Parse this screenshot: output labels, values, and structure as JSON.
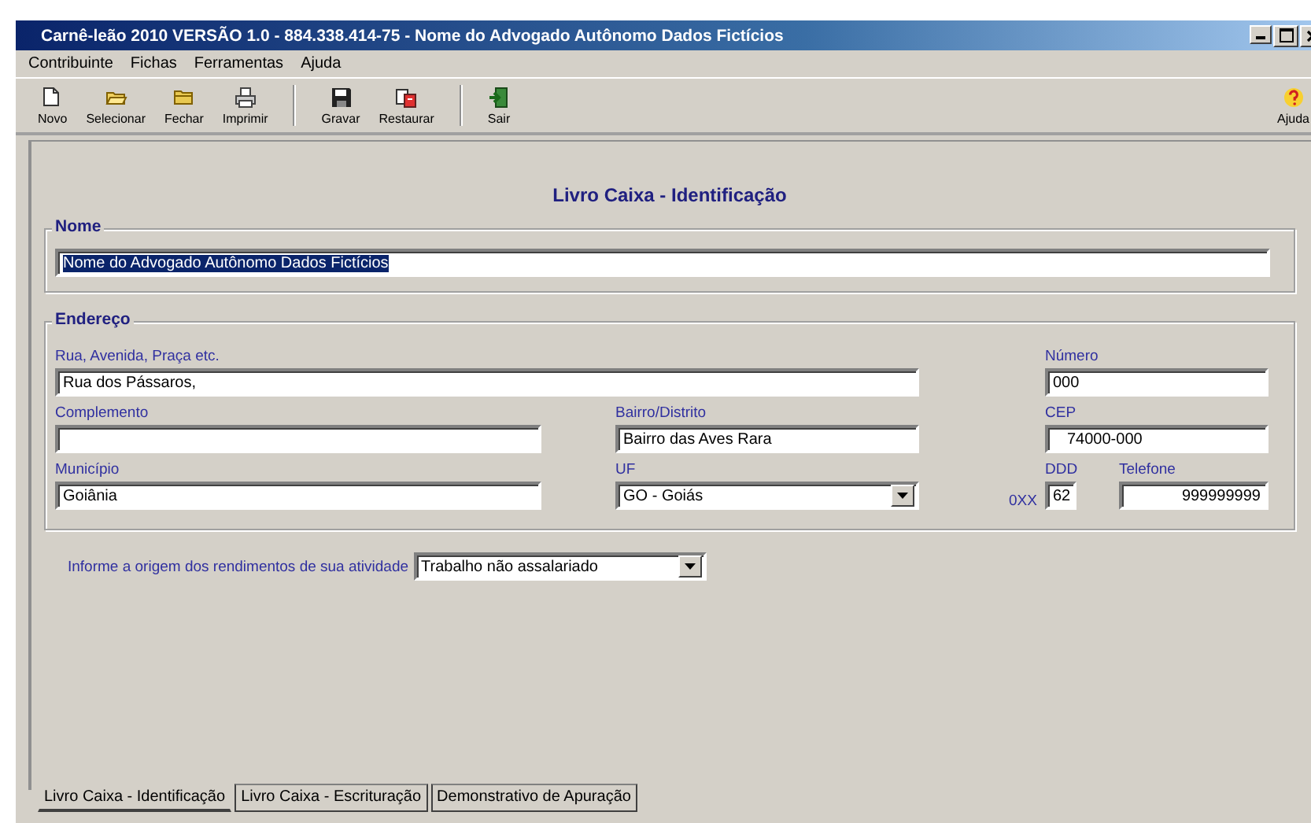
{
  "window": {
    "title": "Carnê-leão 2010 VERSÃO 1.0 - 884.338.414-75 - Nome do Advogado Autônomo Dados Fictícios"
  },
  "menu": [
    "Contribuinte",
    "Fichas",
    "Ferramentas",
    "Ajuda"
  ],
  "toolbar": [
    [
      {
        "label": "Novo",
        "kind": "new"
      },
      {
        "label": "Selecionar",
        "kind": "open"
      },
      {
        "label": "Fechar",
        "kind": "close"
      },
      {
        "label": "Imprimir",
        "kind": "print"
      }
    ],
    [
      {
        "label": "Gravar",
        "kind": "save"
      },
      {
        "label": "Restaurar",
        "kind": "restore"
      }
    ],
    [
      {
        "label": "Sair",
        "kind": "exit"
      }
    ]
  ],
  "help_button": {
    "label": "Ajuda"
  },
  "heading": "Livro Caixa - Identificação",
  "nome": {
    "title": "Nome",
    "value": "Nome do Advogado Autônomo Dados Fictícios",
    "selected": true
  },
  "endereco": {
    "title": "Endereço",
    "fields": [
      {
        "label": "Rua, Avenida, Praça etc.",
        "value": "Rua dos Pássaros,",
        "kind": "text"
      },
      {
        "label": "Número",
        "value": "000",
        "kind": "text"
      },
      {
        "label": "Complemento",
        "kind": "text"
      },
      {
        "label": "Bairro/Distrito",
        "value": "Bairro das Aves Rara",
        "kind": "text"
      },
      {
        "label": "CEP",
        "value": "74000-000",
        "kind": "text"
      },
      {
        "label": "Município",
        "value": "Goiânia",
        "kind": "text"
      },
      {
        "label": "UF",
        "value": "GO - Goiás",
        "kind": "select"
      },
      {
        "label": "DDD",
        "prefix": "0XX",
        "value": "62",
        "kind": "text"
      },
      {
        "label": "Telefone",
        "value": "999999999",
        "kind": "text"
      }
    ]
  },
  "origin": {
    "label": "Informe a origem dos rendimentos de sua atividade",
    "value": "Trabalho não assalariado"
  },
  "tabs": [
    {
      "label": "Livro Caixa - Identificação",
      "selected": true
    },
    {
      "label": "Livro Caixa - Escrituração",
      "selected": false
    },
    {
      "label": "Demonstrativo de Apuração",
      "selected": false
    }
  ]
}
